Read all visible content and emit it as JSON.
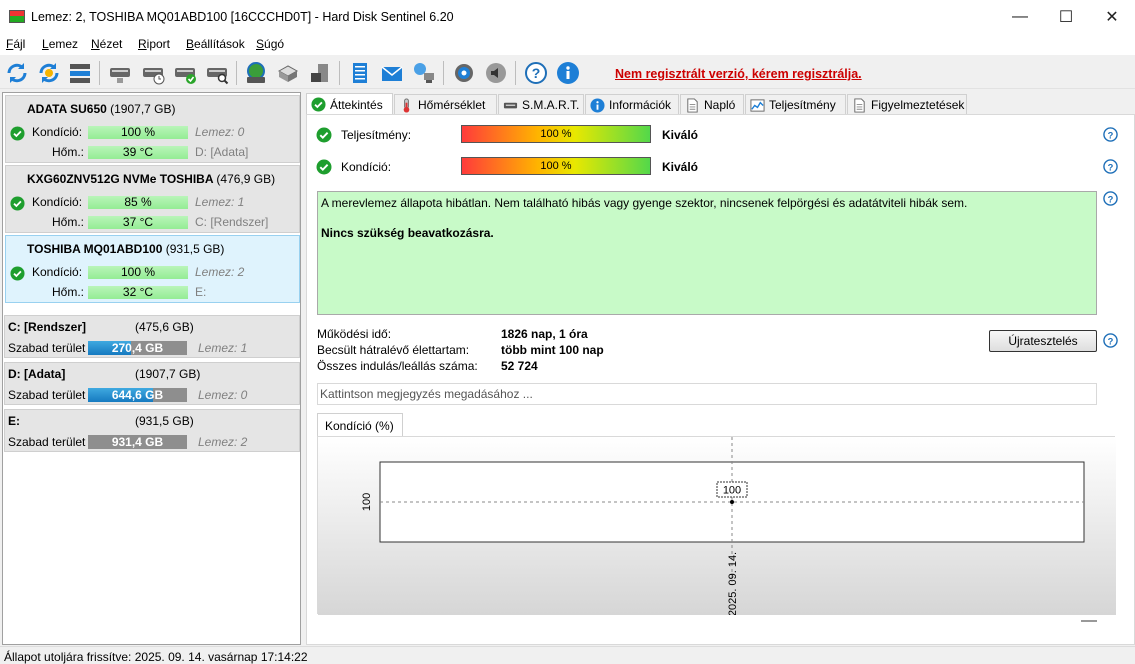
{
  "window": {
    "title": "Lemez: 2, TOSHIBA MQ01ABD100 [16CCCHD0T]  -  Hard Disk Sentinel 6.20",
    "minimize": "—",
    "maximize": "☐",
    "close": "✕"
  },
  "menu": [
    {
      "first": "F",
      "rest": "ájl"
    },
    {
      "first": "L",
      "rest": "emez"
    },
    {
      "first": "N",
      "rest": "ézet"
    },
    {
      "first": "R",
      "rest": "iport"
    },
    {
      "first": "B",
      "rest": "eállítások"
    },
    {
      "first": "S",
      "rest": "úgó"
    }
  ],
  "toolbar": {
    "icons": [
      "refresh-icon",
      "refresh-all-icon",
      "disk-list-icon",
      "disk-test-icon",
      "disk-schedule-icon",
      "disk-ok-icon",
      "disk-search-icon",
      "network-disk-icon",
      "server-icon",
      "backup-icon",
      "report-icon",
      "email-icon",
      "network-icon",
      "settings-icon",
      "sound-icon",
      "help-icon",
      "info-icon"
    ],
    "register_text": "Nem regisztrált verzió, kérem regisztrálja."
  },
  "disks": [
    {
      "name": "ADATA SU650",
      "capacity": "(1907,7 GB)",
      "kondicio_label": "Kondíció:",
      "kondicio": "100 %",
      "kondicio_level": 1.0,
      "lemez": "Lemez: 0",
      "hom_label": "Hőm.:",
      "hom": "39 °C",
      "drive": "D: [Adata]",
      "selected": false
    },
    {
      "name": "KXG60ZNV512G NVMe TOSHIBA",
      "capacity": "(476,9 GB)",
      "kondicio_label": "Kondíció:",
      "kondicio": "85 %",
      "kondicio_level": 0.85,
      "lemez": "Lemez: 1",
      "hom_label": "Hőm.:",
      "hom": "37 °C",
      "drive": "C: [Rendszer]",
      "selected": false
    },
    {
      "name": "TOSHIBA MQ01ABD100",
      "capacity": "(931,5 GB)",
      "kondicio_label": "Kondíció:",
      "kondicio": "100 %",
      "kondicio_level": 1.0,
      "lemez": "Lemez: 2",
      "hom_label": "Hőm.:",
      "hom": "32 °C",
      "drive": "E:",
      "selected": true
    }
  ],
  "volumes": [
    {
      "name": "C: [Rendszer]",
      "size": "(475,6 GB)",
      "free_label": "Szabad terület",
      "free": "270,4 GB",
      "used_fraction": 0.43,
      "disk": "Lemez: 1"
    },
    {
      "name": "D: [Adata]",
      "size": "(1907,7 GB)",
      "free_label": "Szabad terület",
      "free": "644,6 GB",
      "used_fraction": 0.66,
      "disk": "Lemez: 0"
    },
    {
      "name": "E:",
      "size": "(931,5 GB)",
      "free_label": "Szabad terület",
      "free": "931,4 GB",
      "used_fraction": 0.0,
      "disk": "Lemez: 2"
    }
  ],
  "tabs": [
    {
      "label": "Áttekintés",
      "icon": "check-icon",
      "active": true
    },
    {
      "label": "Hőmérséklet",
      "icon": "thermometer-icon",
      "active": false
    },
    {
      "label": "S.M.A.R.T.",
      "icon": "disk-icon",
      "active": false
    },
    {
      "label": "Információk",
      "icon": "info-icon",
      "active": false
    },
    {
      "label": "Napló",
      "icon": "document-icon",
      "active": false
    },
    {
      "label": "Teljesítmény",
      "icon": "chart-icon",
      "active": false
    },
    {
      "label": "Figyelmeztetések",
      "icon": "warning-doc-icon",
      "active": false
    }
  ],
  "overview": {
    "performance_label": "Teljesítmény:",
    "performance_value": "100 %",
    "performance_rating": "Kiváló",
    "condition_label": "Kondíció:",
    "condition_value": "100 %",
    "condition_rating": "Kiváló",
    "status_text": "A merevlemez állapota hibátlan. Nem található hibás vagy gyenge szektor, nincsenek felpörgési és adatátviteli hibák sem.",
    "status_action": "Nincs szükség beavatkozásra.",
    "uptime_label": "Működési idő:",
    "uptime_value": "1826 nap, 1 óra",
    "lifetime_label": "Becsült hátralévő élettartam:",
    "lifetime_value": "több mint 100 nap",
    "starts_label": "Összes indulás/leállás száma:",
    "starts_value": "52 724",
    "retest_button": "Újratesztelés",
    "note_placeholder": "Kattintson megjegyzés megadásához ..."
  },
  "chart_tab": "Kondíció  (%)",
  "chart_data": {
    "type": "line",
    "x": [
      "2025. 09. 14."
    ],
    "series": [
      {
        "values": [
          100
        ]
      }
    ],
    "y_tick_labels": [
      "100"
    ],
    "data_labels": [
      "100"
    ],
    "grid": true
  },
  "statusbar": {
    "text": "Állapot utoljára frissítve: 2025. 09. 14. vasárnap 17:14:22"
  }
}
